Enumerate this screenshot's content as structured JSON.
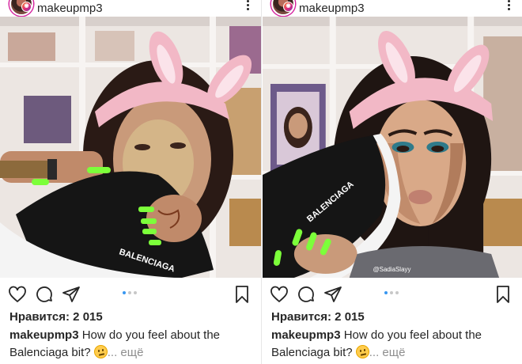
{
  "posts": [
    {
      "username": "makeupmp3",
      "likes": "Нравится: 2 015",
      "caption_user": "makeupmp3",
      "caption_text": "How do you feel about the Balenciaga bit?",
      "more_text": "... ещё",
      "carousel_active": 1,
      "photo": {
        "shoe_label": "BALENCIAGA",
        "watermark": ""
      }
    },
    {
      "username": "makeupmp3",
      "likes": "Нравится: 2 015",
      "caption_user": "makeupmp3",
      "caption_text": "How do you feel about the Balenciaga bit?",
      "more_text": "... ещё",
      "carousel_active": 1,
      "photo": {
        "shoe_label": "BALENCIAGA",
        "watermark": "@SadiaSlayy"
      }
    }
  ],
  "icons": {
    "heart": "heart-icon",
    "comment": "comment-icon",
    "share": "share-icon",
    "bookmark": "bookmark-icon",
    "more": "more-options-icon",
    "story_badge": "story-badge-icon"
  },
  "colors": {
    "accent_blue": "#3897f0",
    "nail_green": "#7cff3a",
    "headband_pink": "#f2b8c6",
    "shoe_black": "#151515",
    "sole_white": "#f4f4f4"
  }
}
